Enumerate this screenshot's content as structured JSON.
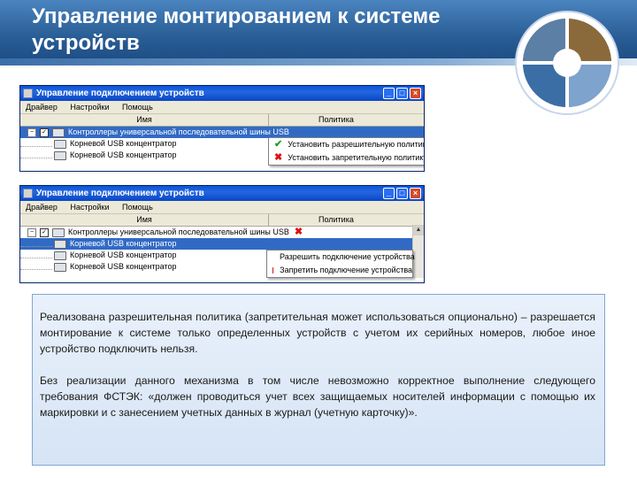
{
  "slide": {
    "title": "Управление монтированием к системе устройств"
  },
  "window1": {
    "title": "Управление подключением устройств",
    "menu": [
      "Драйвер",
      "Настройки",
      "Помощь"
    ],
    "col_name": "Имя",
    "col_policy": "Политика",
    "rows": [
      "Контроллеры универсальной последовательной шины USB",
      "Корневой USB концентратор",
      "Корневой USB концентратор"
    ],
    "popup": [
      "Установить разрешительную политику",
      "Установить запретительную политику"
    ]
  },
  "window2": {
    "title": "Управление подключением устройств",
    "menu": [
      "Драйвер",
      "Настройки",
      "Помощь"
    ],
    "col_name": "Имя",
    "col_policy": "Политика",
    "rows": [
      "Контроллеры универсальной последовательной шины USB",
      "Корневой USB концентратор",
      "Корневой USB концентратор",
      "Корневой USB концентратор"
    ],
    "popup": [
      "Разрешить подключение устройства",
      "Запретить подключение устройства"
    ]
  },
  "text": {
    "p1": "Реализована разрешительная политика (запретительная может использоваться опционально) – разрешается монтирование к системе только определенных устройств с учетом их серийных номеров, любое иное устройство подключить нельзя.",
    "p2": "Без реализации данного механизма в том числе невозможно корректное выполнение следующего требования ФСТЭК: «должен проводиться учет всех защищаемых носителей информации с помощью их маркировки и с занесением учетных данных в журнал (учетную карточку)»."
  },
  "colors": {
    "banner": "#2b5f97",
    "titlebar": "#0a55d8",
    "selection": "#316ac5",
    "allow": "#20a020",
    "deny": "#e01010"
  }
}
